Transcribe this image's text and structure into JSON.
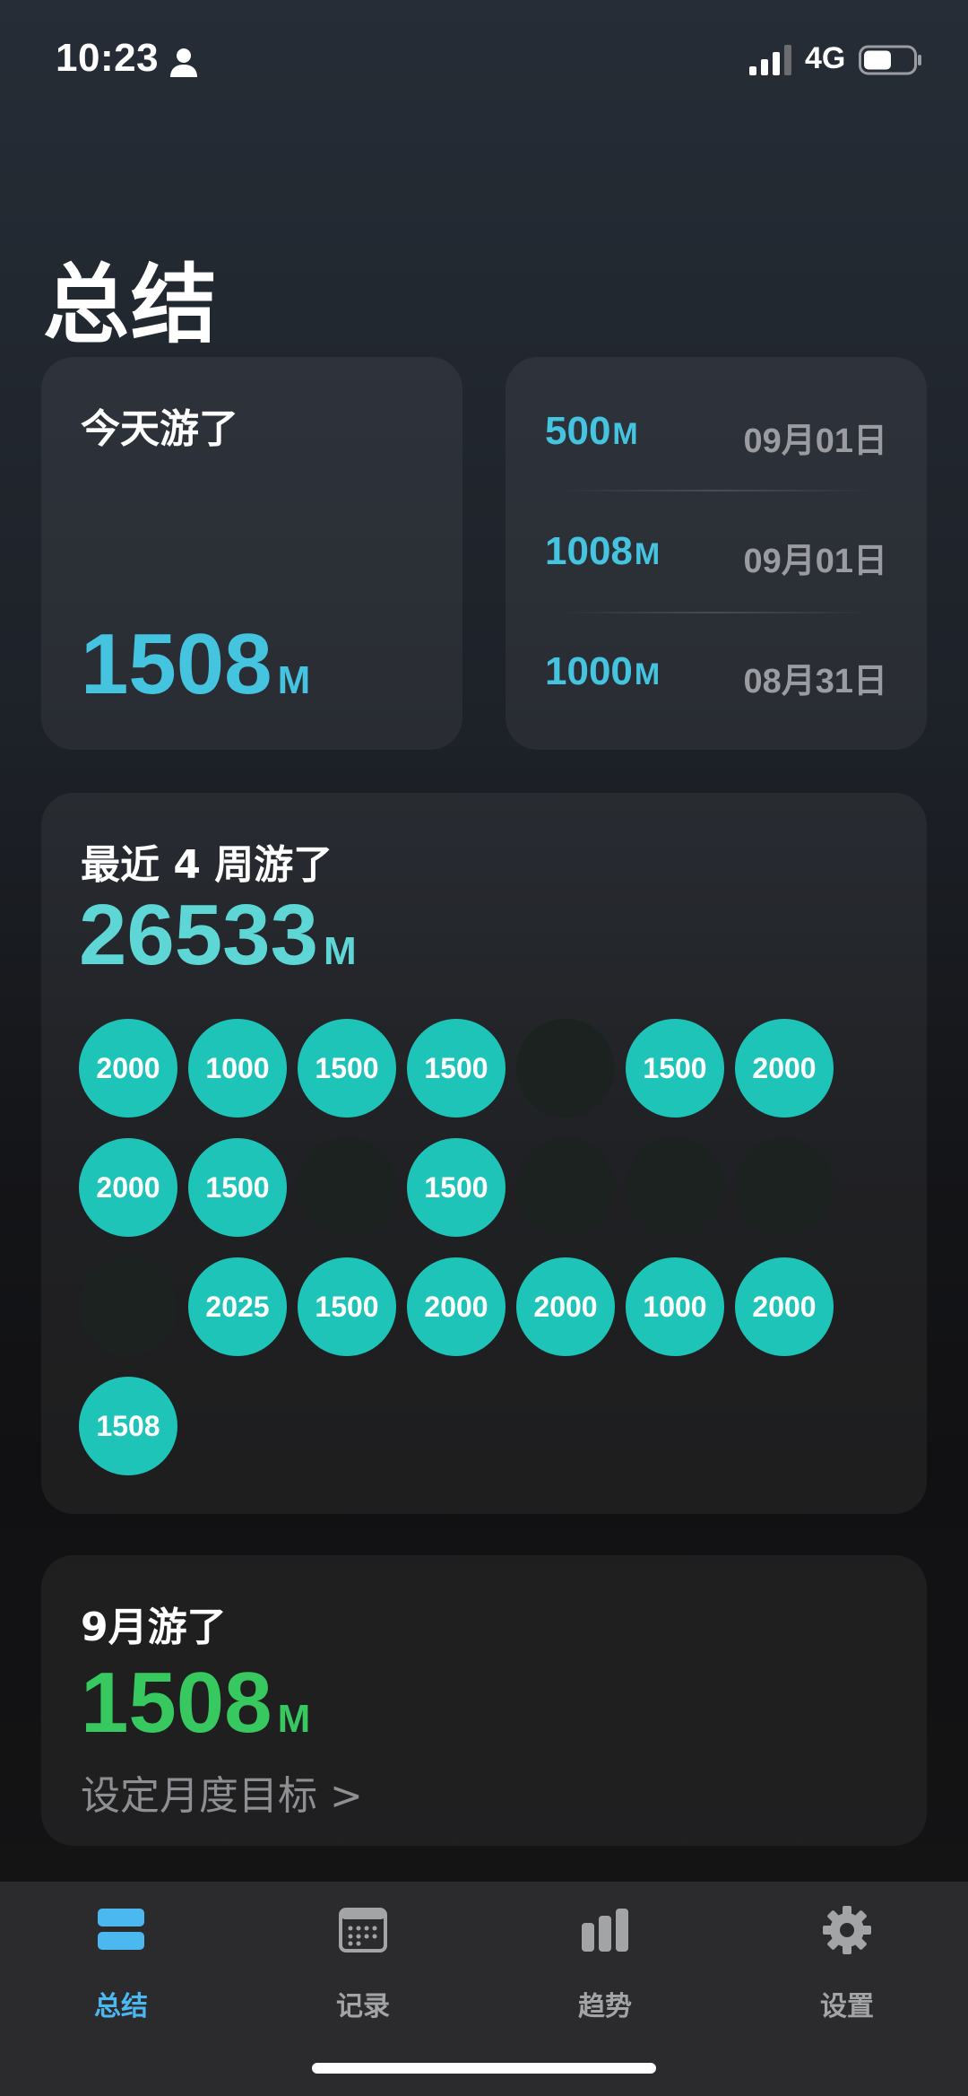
{
  "status_bar": {
    "time": "10:23",
    "network": "4G",
    "battery_level": 0.55
  },
  "title": "总结",
  "today": {
    "label": "今天游了",
    "value": "1508",
    "unit": "M"
  },
  "recent": [
    {
      "distance": "500",
      "unit": "M",
      "date": "09月01日"
    },
    {
      "distance": "1008",
      "unit": "M",
      "date": "09月01日"
    },
    {
      "distance": "1000",
      "unit": "M",
      "date": "08月31日"
    }
  ],
  "four_weeks": {
    "label": "最近 4 周游了",
    "value": "26533",
    "unit": "M",
    "days": [
      "2000",
      "1000",
      "1500",
      "1500",
      "",
      "1500",
      "2000",
      "2000",
      "1500",
      "",
      "1500",
      "",
      "",
      "",
      "",
      "2025",
      "1500",
      "2000",
      "2000",
      "1000",
      "2000",
      "1508"
    ]
  },
  "month": {
    "label": "9月游了",
    "value": "1508",
    "unit": "M",
    "goal_link": "设定月度目标 >"
  },
  "tabs": [
    {
      "label": "总结",
      "icon": "summary-icon",
      "active": true
    },
    {
      "label": "记录",
      "icon": "calendar-icon",
      "active": false
    },
    {
      "label": "趋势",
      "icon": "bar-chart-icon",
      "active": false
    },
    {
      "label": "设置",
      "icon": "gear-icon",
      "active": false
    }
  ],
  "colors": {
    "accent_blue": "#45c4e0",
    "teal": "#1fc4b9",
    "green": "#37c960",
    "tab_active": "#4cb8f0"
  }
}
